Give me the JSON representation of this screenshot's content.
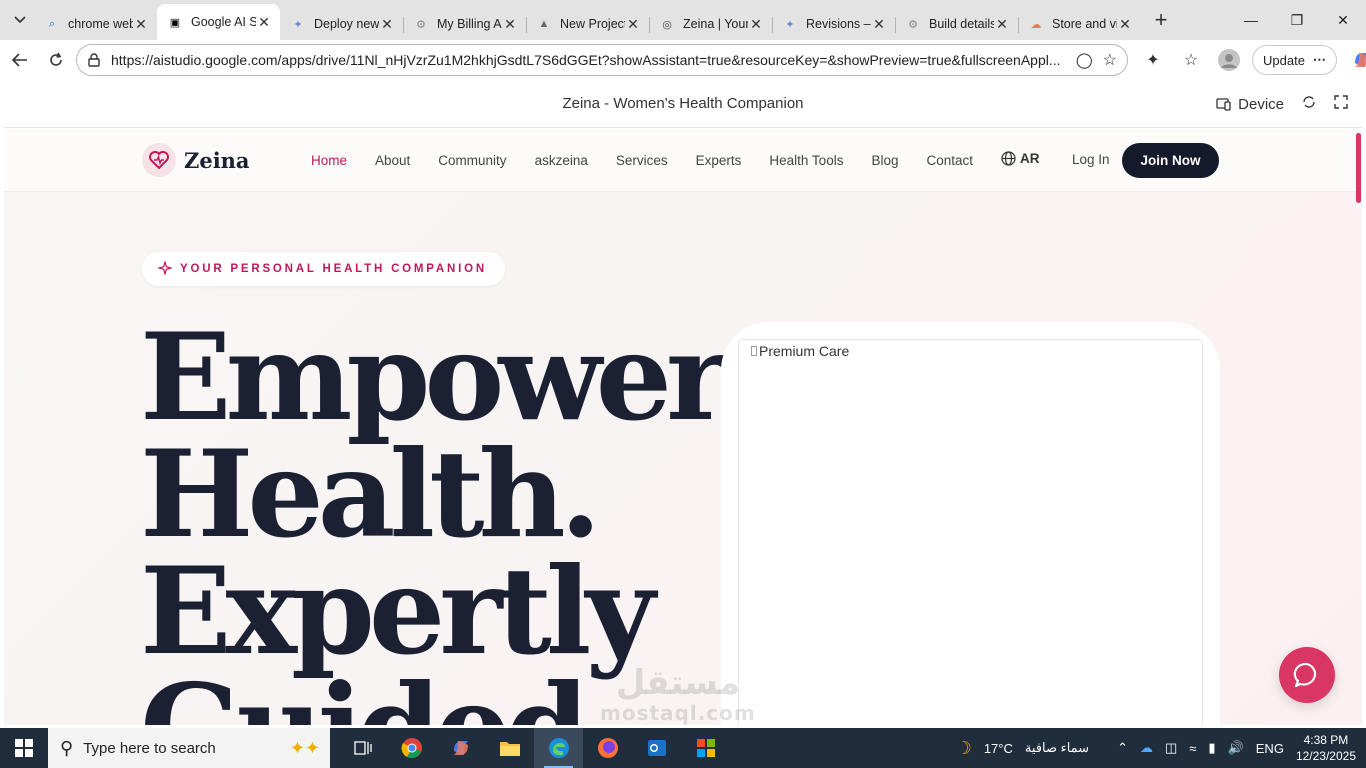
{
  "browser": {
    "tabs": [
      {
        "title": "chrome web",
        "favicon": "search-favicon",
        "active": false
      },
      {
        "title": "Google AI St",
        "favicon": "ai-studio-favicon",
        "active": true
      },
      {
        "title": "Deploy new",
        "favicon": "deploy-favicon",
        "active": false
      },
      {
        "title": "My Billing Ac",
        "favicon": "gear-favicon",
        "active": false
      },
      {
        "title": "New Project",
        "favicon": "triangle-favicon",
        "active": false
      },
      {
        "title": "Zeina | Your",
        "favicon": "globe-favicon",
        "active": false
      },
      {
        "title": "Revisions – c",
        "favicon": "deploy-favicon",
        "active": false
      },
      {
        "title": "Build details",
        "favicon": "gear-favicon",
        "active": false
      },
      {
        "title": "Store and vi",
        "favicon": "cloud-favicon",
        "active": false
      }
    ],
    "url": "https://aistudio.google.com/apps/drive/11Nl_nHjVzrZu1M2hkhjGsdtL7S6dGGEt?showAssistant=true&resourceKey=&showPreview=true&fullscreenAppl...",
    "update_label": "Update"
  },
  "preview": {
    "title": "Zeina - Women's Health Companion",
    "device_label": "Device"
  },
  "site": {
    "brand": "Zeina",
    "nav": [
      "Home",
      "About",
      "Community",
      "askzeina",
      "Services",
      "Experts",
      "Health Tools",
      "Blog",
      "Contact"
    ],
    "active_nav": "Home",
    "lang": "AR",
    "login": "Log In",
    "join": "Join Now",
    "badge": "YOUR PERSONAL HEALTH COMPANION",
    "hero_lines": [
      "Empower",
      "Health.",
      "Expertly",
      "Guided."
    ],
    "image_alt": "Premium Care",
    "accent_color": "#c2185b",
    "dark_color": "#141a2b"
  },
  "watermark": {
    "ar": "مستقل",
    "en": "mostaql.com"
  },
  "taskbar": {
    "search_placeholder": "Type here to search",
    "weather_temp": "17°C",
    "weather_desc": "سماء صافية",
    "lang": "ENG",
    "time": "4:38 PM",
    "date": "12/23/2025"
  }
}
